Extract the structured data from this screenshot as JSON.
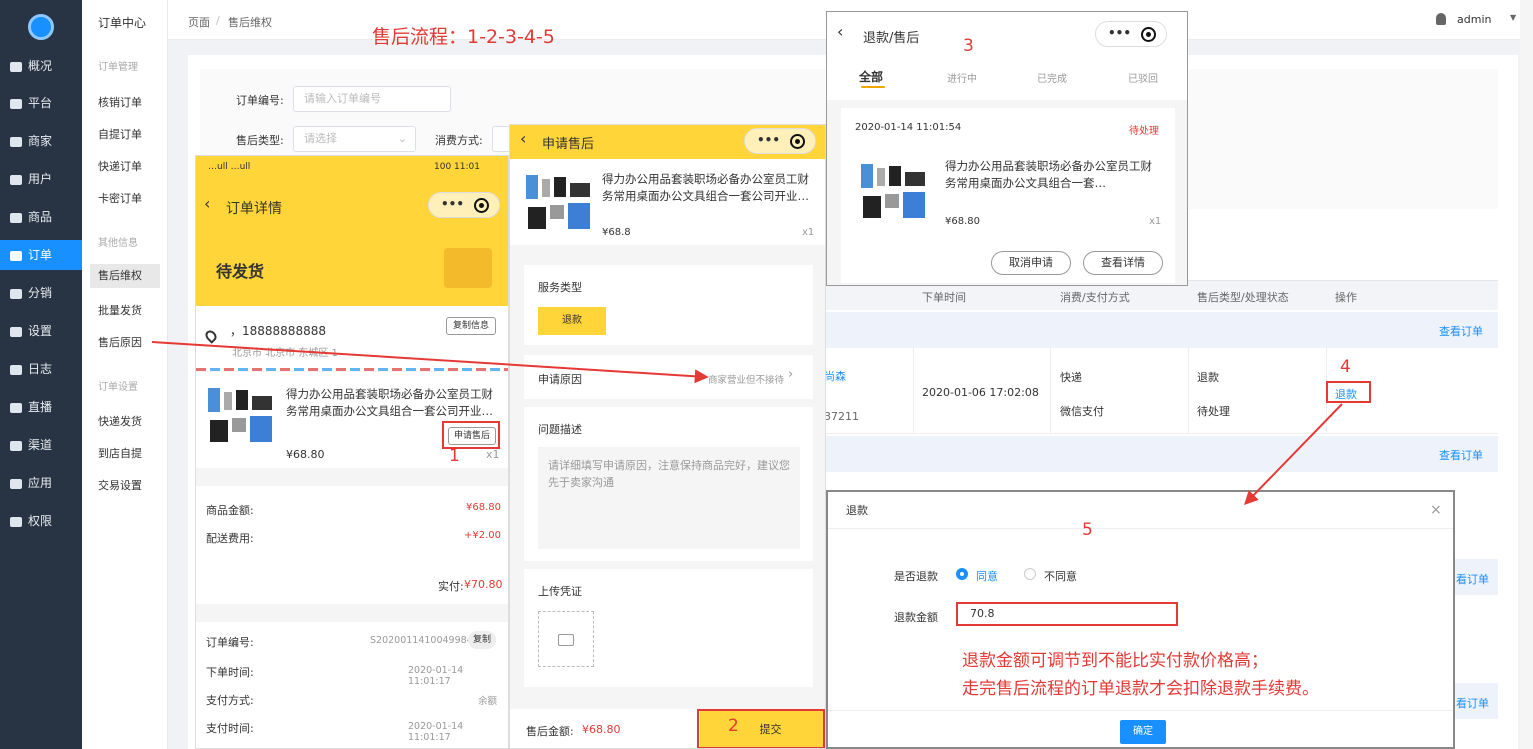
{
  "sidebar": {
    "items": [
      "概况",
      "平台",
      "商家",
      "用户",
      "商品",
      "订单",
      "分销",
      "设置",
      "日志",
      "直播",
      "渠道",
      "应用",
      "权限"
    ],
    "active_index": 5
  },
  "subnav": {
    "title": "订单中心",
    "group1": "订单管理",
    "items1": [
      "核销订单",
      "自提订单",
      "快递订单",
      "卡密订单"
    ],
    "group2": "其他信息",
    "items2": [
      "售后维权",
      "批量发货",
      "售后原因"
    ],
    "group3": "订单设置",
    "items3": [
      "快递发货",
      "到店自提",
      "交易设置"
    ]
  },
  "topbar": {
    "crumb1": "页面",
    "sep": "/",
    "crumb2": "售后维权",
    "user": "admin"
  },
  "annotation": {
    "flow": "售后流程：1-2-3-4-5",
    "n1": "1",
    "n2": "2",
    "n3": "3",
    "n4": "4",
    "n5": "5",
    "note1": "退款金额可调节到不能比实付款价格高；",
    "note2": "走完售后流程的订单退款才会扣除退款手续费。"
  },
  "filters": {
    "order_no_label": "订单编号:",
    "order_no_placeholder": "请输入订单编号",
    "type_label": "售后类型:",
    "type_placeholder": "请选择",
    "consume_label": "消费方式:"
  },
  "table": {
    "headers": [
      "下单时间",
      "消费/支付方式",
      "售后类型/处理状态",
      "操作"
    ],
    "view_order": "查看订单",
    "row": {
      "name_frag": "尚森",
      "id_frag": "37211",
      "time": "2020-01-06 17:02:08",
      "consume": "快递",
      "pay": "微信支付",
      "type": "退款",
      "status": "待处理",
      "action": "退款"
    },
    "view_order_partial": "看订单"
  },
  "phone1": {
    "status_left": "…ull …ull",
    "status_right": "100 11:01",
    "title": "订单详情",
    "banner": "待发货",
    "addr_name": "，18888888888",
    "copy_info": "复制信息",
    "addr": "北京市 北京市 东城区 1",
    "product_name": "得力办公用品套装职场必备办公室员工财务常用桌面办公文具组合一套公司开业…",
    "apply_btn": "申请售后",
    "price": "¥68.80",
    "qty": "x1",
    "goods_amount_label": "商品金额:",
    "goods_amount": "¥68.80",
    "ship_label": "配送费用:",
    "ship": "+¥2.00",
    "paid_label": "实付:",
    "paid": "¥70.80",
    "order_no_label": "订单编号:",
    "order_no": "S20200114100499​84",
    "copy": "复制",
    "order_time_label": "下单时间:",
    "order_time": "2020-01-14 11:01:17",
    "pay_label": "支付方式:",
    "pay": "余额",
    "pay_time_label": "支付时间:",
    "pay_time": "2020-01-14 11:01:17"
  },
  "phone2": {
    "title": "申请售后",
    "product_name": "得力办公用品套装职场必备办公室员工财务常用桌面办公文具组合一套公司开业…",
    "price": "¥68.8",
    "qty": "x1",
    "service_type_label": "服务类型",
    "service_type": "退款",
    "reason_label": "申请原因",
    "reason_value": "商家营业但不接待",
    "desc_label": "问题描述",
    "desc_placeholder": "请详细填写申请原因，注意保持商品完好，建议您先于卖家沟通",
    "upload_label": "上传凭证",
    "total_label": "售后金额:",
    "total": "¥68.80",
    "submit": "提交"
  },
  "phone3": {
    "title": "退款/售后",
    "tabs": [
      "全部",
      "进行中",
      "已完成",
      "已驳回"
    ],
    "time": "2020-01-14 11:01:54",
    "status": "待处理",
    "product_name": "得力办公用品套装职场必备办公室员工财务常用桌面办公文具组合一套…",
    "price": "¥68.80",
    "qty": "x1",
    "cancel": "取消申请",
    "detail": "查看详情"
  },
  "dialog": {
    "title": "退款",
    "close": "×",
    "agree_label": "是否退款",
    "agree": "同意",
    "disagree": "不同意",
    "amount_label": "退款金额",
    "amount": "70.8",
    "confirm": "确定"
  },
  "colors": {
    "accent": "#1890ff",
    "yellow": "#ffd53a",
    "red": "#e53935"
  }
}
